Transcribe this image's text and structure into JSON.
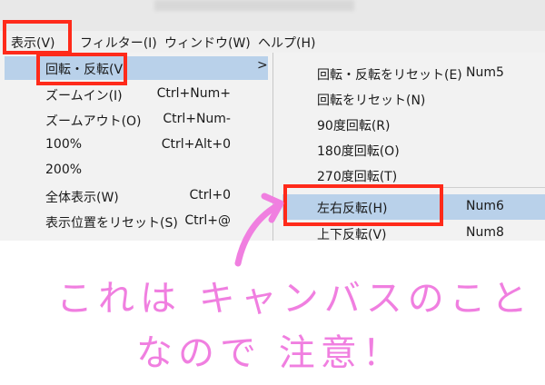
{
  "menubar": {
    "items": [
      "表示(V)",
      "フィルター(I)",
      "ウィンドウ(W)",
      "ヘルプ(H)"
    ]
  },
  "view_menu": {
    "items": [
      {
        "label": "回転・反転(V",
        "shortcut": ""
      },
      {
        "label": "ズームイン(I)",
        "shortcut": "Ctrl+Num+"
      },
      {
        "label": "ズームアウト(O)",
        "shortcut": "Ctrl+Num-"
      },
      {
        "label": "100%",
        "shortcut": "Ctrl+Alt+0"
      },
      {
        "label": "200%",
        "shortcut": ""
      },
      {
        "label": "全体表示(W)",
        "shortcut": "Ctrl+0"
      },
      {
        "label": "表示位置をリセット(S)",
        "shortcut": "Ctrl+@"
      }
    ],
    "submenu_arrow": ">"
  },
  "rotate_submenu": {
    "items": [
      {
        "label": "回転・反転をリセット(E)",
        "shortcut": "Num5"
      },
      {
        "label": "回転をリセット(N)",
        "shortcut": ""
      },
      {
        "label": "90度回転(R)",
        "shortcut": ""
      },
      {
        "label": "180度回転(O)",
        "shortcut": ""
      },
      {
        "label": "270度回転(T)",
        "shortcut": ""
      },
      {
        "label": "左右反転(H)",
        "shortcut": "Num6"
      },
      {
        "label": "上下反転(V)",
        "shortcut": "Num8"
      }
    ]
  },
  "annotation": {
    "line1": "これは キャンバスのこと",
    "line2": "なので 注意！",
    "color": "#f07fe0",
    "highlight_color": "#ff2a1a"
  }
}
